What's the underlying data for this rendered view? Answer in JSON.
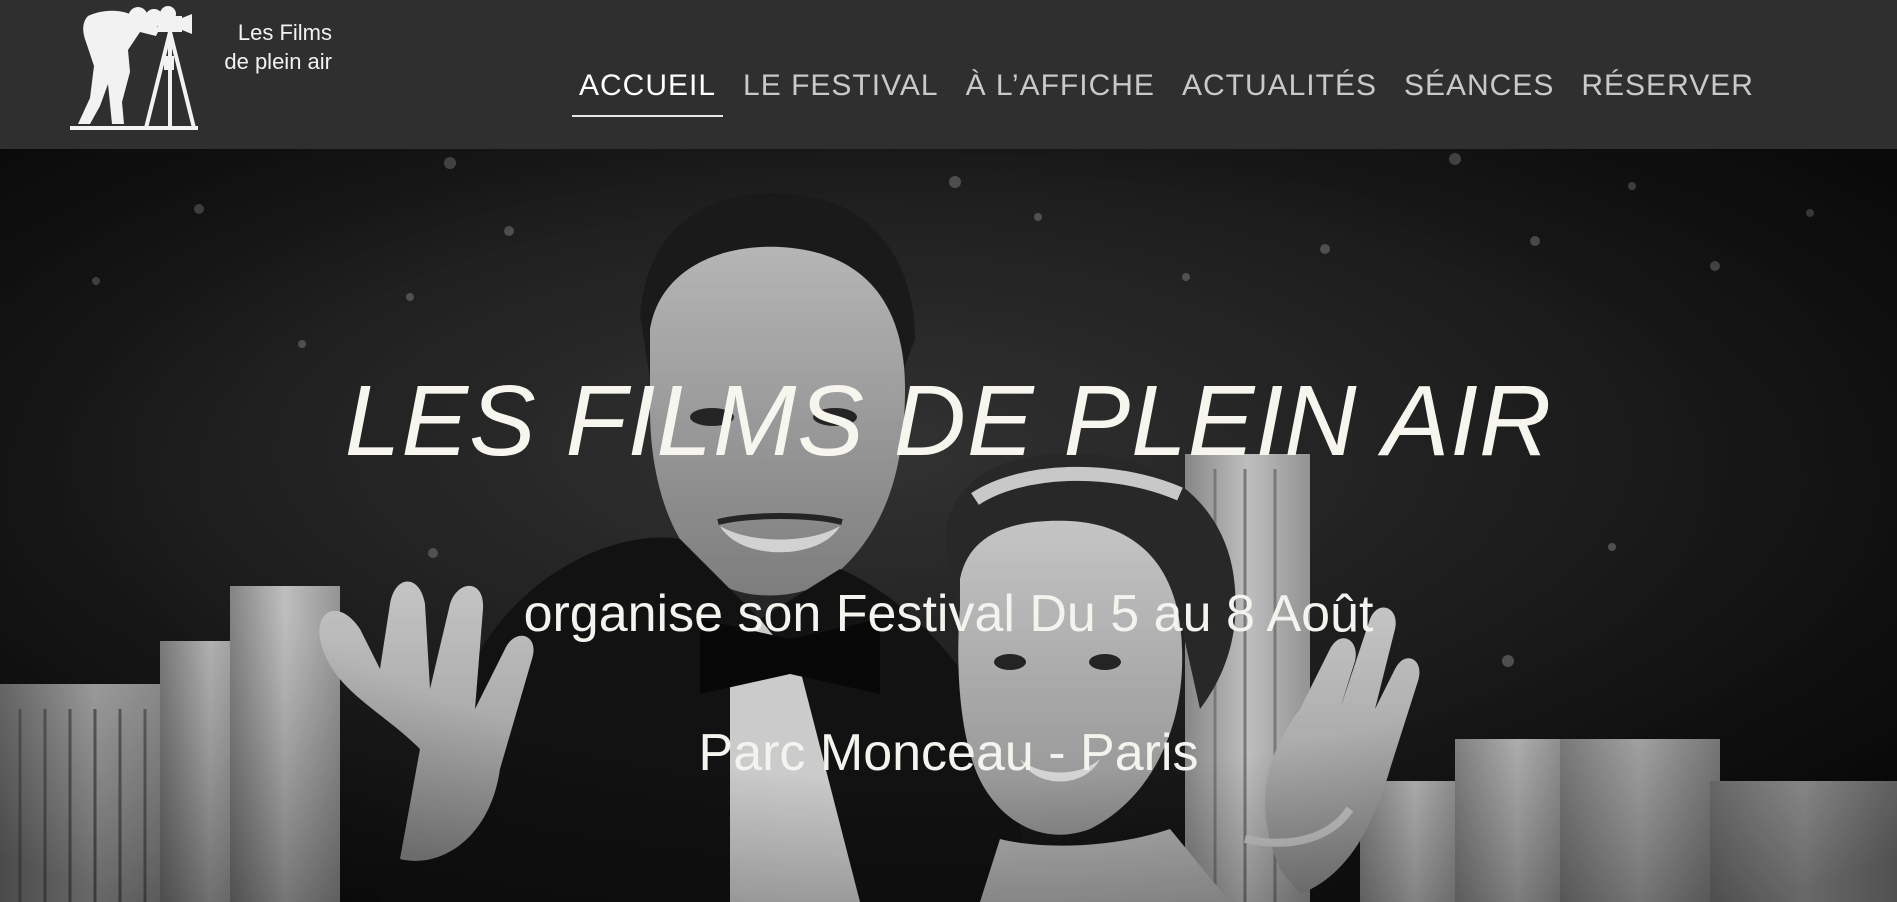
{
  "header": {
    "logo": {
      "line1": "Les Films",
      "line2": "de plein air"
    },
    "nav": [
      {
        "label": "ACCUEIL",
        "active": true
      },
      {
        "label": "LE FESTIVAL",
        "active": false
      },
      {
        "label": "À L’AFFICHE",
        "active": false
      },
      {
        "label": "ACTUALITÉS",
        "active": false
      },
      {
        "label": "SÉANCES",
        "active": false
      },
      {
        "label": "RÉSERVER",
        "active": false
      }
    ]
  },
  "hero": {
    "title": "LES FILMS DE PLEIN AIR",
    "subtitle": "organise son Festival Du 5 au 8 Août",
    "location": "Parc Monceau - Paris"
  },
  "colors": {
    "header_bg": "#2f2f30",
    "nav_text": "#c9c9c9",
    "nav_active": "#ffffff",
    "hero_text": "#f6f6ef"
  },
  "icons": {
    "logo": "cameraman-silhouette-icon"
  }
}
